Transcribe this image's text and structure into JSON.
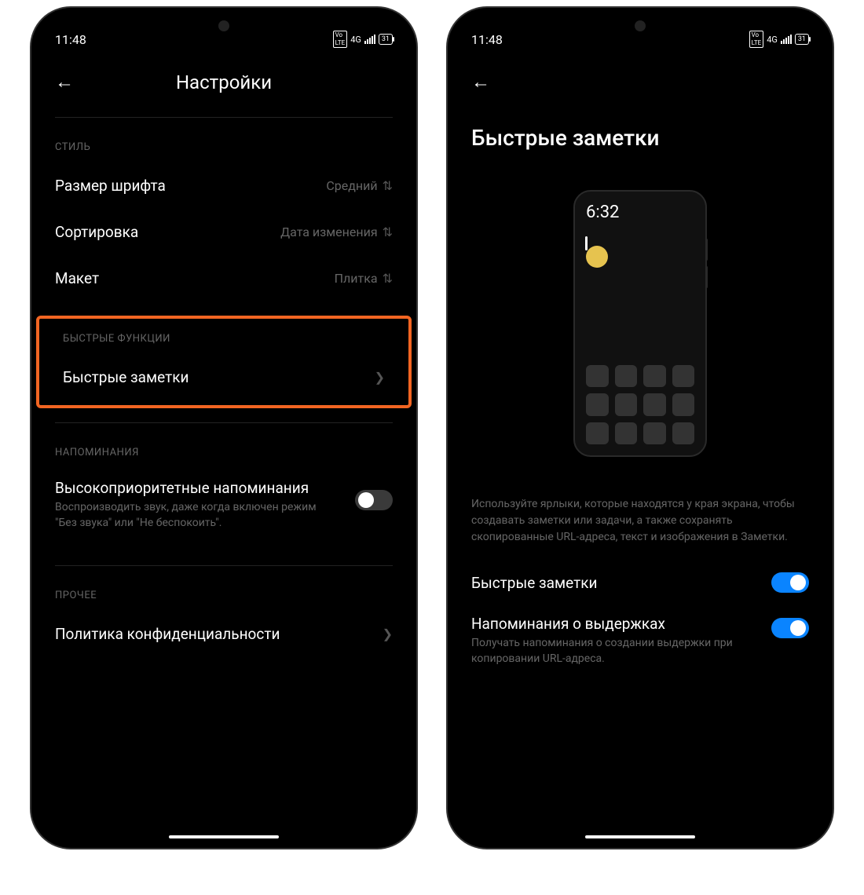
{
  "status": {
    "time": "11:48",
    "network": "4G",
    "battery": "31"
  },
  "left": {
    "title": "Настройки",
    "sections": {
      "style": {
        "label": "СТИЛЬ",
        "fontSize": {
          "label": "Размер шрифта",
          "value": "Средний"
        },
        "sort": {
          "label": "Сортировка",
          "value": "Дата изменения"
        },
        "layout": {
          "label": "Макет",
          "value": "Плитка"
        }
      },
      "quick": {
        "label": "БЫСТРЫЕ ФУНКЦИИ",
        "notes": {
          "label": "Быстрые заметки"
        }
      },
      "reminders": {
        "label": "НАПОМИНАНИЯ",
        "priority": {
          "label": "Высокоприоритетные напоминания",
          "desc": "Воспроизводить звук, даже когда включен режим \"Без звука\" или \"Не беспокоить\"."
        }
      },
      "other": {
        "label": "ПРОЧЕЕ",
        "privacy": {
          "label": "Политика конфиденциальности"
        }
      }
    }
  },
  "right": {
    "title": "Быстрые заметки",
    "illustrationTime": "6:32",
    "desc": "Используйте ярлыки, которые находятся у края экрана, чтобы создавать заметки или задачи, а также сохранять скопированные URL-адреса, текст и изображения в Заметки.",
    "toggles": {
      "quick": {
        "label": "Быстрые заметки"
      },
      "excerpt": {
        "label": "Напоминания о выдержках",
        "desc": "Получать напоминания о создании выдержки при копировании URL-адреса."
      }
    }
  }
}
